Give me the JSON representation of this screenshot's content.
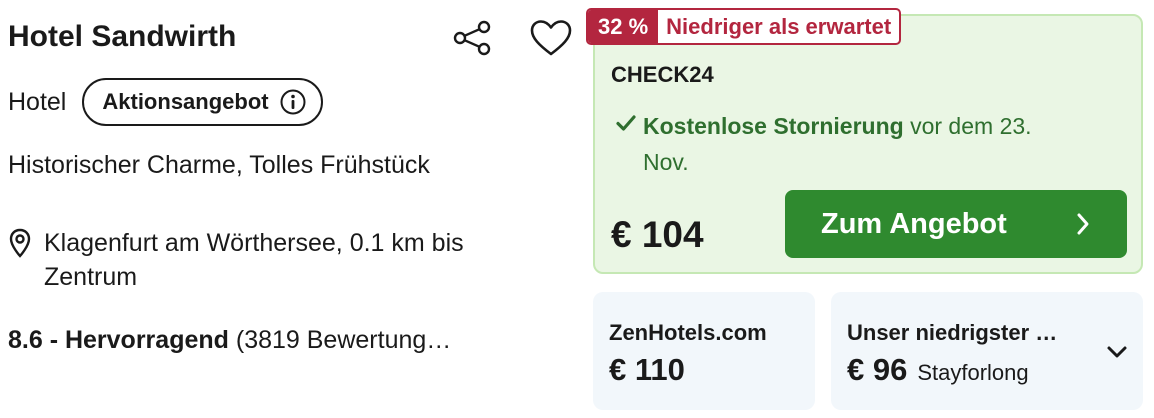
{
  "hotel": {
    "name": "Hotel Sandwirth",
    "type": "Hotel",
    "promo_label": "Aktionsangebot",
    "highlights": "Historischer Charme, Tolles Frühstück",
    "location": "Klagenfurt am Wörthersee, 0.1 km bis Zentrum",
    "rating_score": "8.6 - Hervorragend",
    "rating_count": "(3819 Bewertung…"
  },
  "icons": {
    "share": "share-icon",
    "favorite": "heart-icon",
    "info": "info-icon",
    "location": "map-pin-icon",
    "check": "check-icon",
    "cta_chevron": "chevron-right-icon",
    "expand": "chevron-down-icon"
  },
  "deal": {
    "discount_percent": "32 %",
    "discount_text": "Niedriger als erwartet",
    "provider": "CHECK24",
    "cancellation_strong": "Kostenlose Stornierung",
    "cancellation_rest": " vor dem 23. Nov.",
    "price": "€ 104",
    "cta_label": "Zum Angebot"
  },
  "alternatives": [
    {
      "name": "ZenHotels.com",
      "price": "€ 110"
    },
    {
      "name": "Unser niedrigster …",
      "price": "€ 96",
      "provider": "Stayforlong"
    }
  ],
  "colors": {
    "deal_bg": "#eaf6e4",
    "deal_border": "#c5e8b4",
    "discount_red": "#b3263f",
    "cancel_green": "#2f6f2f",
    "cta_green": "#2f8a2f",
    "alt_bg": "#f2f7fb"
  }
}
